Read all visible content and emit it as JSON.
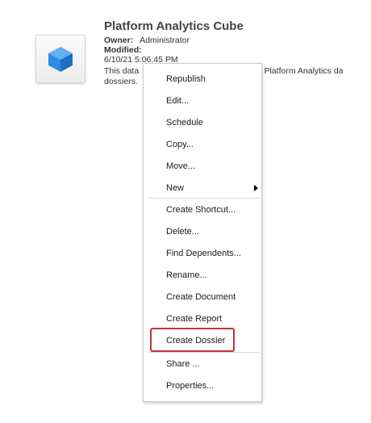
{
  "object": {
    "title": "Platform Analytics Cube",
    "owner_label": "Owner:",
    "owner_value": "Administrator",
    "modified_label": "Modified:",
    "modified_value": "6/10/21 5:06:45 PM",
    "description_left": "This data",
    "description_right": "worth of Platform Analytics da",
    "description_line2": "dossiers.",
    "icon": "cube-icon",
    "icon_color": "#2f8be0"
  },
  "context_menu": {
    "items": [
      {
        "label": "Republish"
      },
      {
        "label": "Edit..."
      },
      {
        "label": "Schedule"
      },
      {
        "label": "Copy..."
      },
      {
        "label": "Move..."
      },
      {
        "label": "New",
        "submenu": true
      },
      {
        "label": "Create Shortcut..."
      },
      {
        "label": "Delete..."
      },
      {
        "label": "Find Dependents..."
      },
      {
        "label": "Rename..."
      },
      {
        "label": "Create Document"
      },
      {
        "label": "Create Report"
      },
      {
        "label": "Create Dossier",
        "highlighted": true
      },
      {
        "label": "Share ..."
      },
      {
        "label": "Properties..."
      }
    ],
    "highlight_color": "#c2343a"
  }
}
